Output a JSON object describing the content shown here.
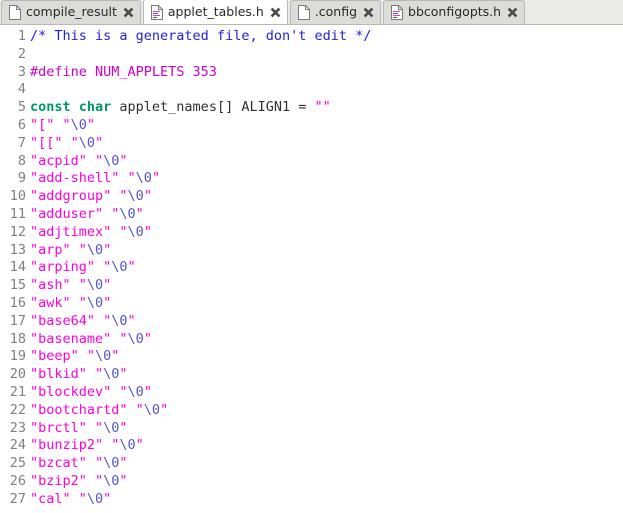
{
  "window": {
    "title": "applet_tables.h"
  },
  "tabbar": {
    "tabs": [
      {
        "label": "compile_result",
        "icon": "plain-document-icon",
        "close_icon": "close-icon",
        "active": false
      },
      {
        "label": "applet_tables.h",
        "icon": "text-document-icon",
        "close_icon": "close-icon",
        "active": true
      },
      {
        "label": ".config",
        "icon": "plain-document-icon",
        "close_icon": "close-icon",
        "active": false
      },
      {
        "label": "bbconfigopts.h",
        "icon": "text-document-icon",
        "close_icon": "close-icon",
        "active": false
      }
    ]
  },
  "colors": {
    "comment": "#2222dd",
    "preprocessor": "#cc00cc",
    "keyword": "#009966",
    "identifier": "#303030",
    "string": "#ff00dd",
    "escape": "#5555cc",
    "linenumber": "#808080",
    "tab_active_bg": "#ffffff",
    "tab_inactive_bg": "#dcdcd8",
    "tabbar_bg": "#ebebe9",
    "editor_bg": "#ffffff"
  },
  "editor": {
    "lines": [
      {
        "n": "1",
        "tokens": [
          {
            "t": "/* This is a generated file, don't edit */",
            "c": "comment"
          }
        ]
      },
      {
        "n": "2",
        "tokens": []
      },
      {
        "n": "3",
        "tokens": [
          {
            "t": "#define NUM_APPLETS 353",
            "c": "preprocessor"
          }
        ]
      },
      {
        "n": "4",
        "tokens": []
      },
      {
        "n": "5",
        "tokens": [
          {
            "t": "const char",
            "c": "keyword",
            "bold": true
          },
          {
            "t": " applet_names[] ALIGN1 = ",
            "c": "identifier"
          },
          {
            "t": "\"\"",
            "c": "string"
          }
        ]
      },
      {
        "n": "6",
        "tokens": [
          {
            "t": "\"[\" \"",
            "c": "string"
          },
          {
            "t": "\\0",
            "c": "escape"
          },
          {
            "t": "\"",
            "c": "string"
          }
        ]
      },
      {
        "n": "7",
        "tokens": [
          {
            "t": "\"[[\" \"",
            "c": "string"
          },
          {
            "t": "\\0",
            "c": "escape"
          },
          {
            "t": "\"",
            "c": "string"
          }
        ]
      },
      {
        "n": "8",
        "tokens": [
          {
            "t": "\"acpid\" \"",
            "c": "string"
          },
          {
            "t": "\\0",
            "c": "escape"
          },
          {
            "t": "\"",
            "c": "string"
          }
        ]
      },
      {
        "n": "9",
        "tokens": [
          {
            "t": "\"add-shell\" \"",
            "c": "string"
          },
          {
            "t": "\\0",
            "c": "escape"
          },
          {
            "t": "\"",
            "c": "string"
          }
        ]
      },
      {
        "n": "10",
        "tokens": [
          {
            "t": "\"addgroup\" \"",
            "c": "string"
          },
          {
            "t": "\\0",
            "c": "escape"
          },
          {
            "t": "\"",
            "c": "string"
          }
        ]
      },
      {
        "n": "11",
        "tokens": [
          {
            "t": "\"adduser\" \"",
            "c": "string"
          },
          {
            "t": "\\0",
            "c": "escape"
          },
          {
            "t": "\"",
            "c": "string"
          }
        ]
      },
      {
        "n": "12",
        "tokens": [
          {
            "t": "\"adjtimex\" \"",
            "c": "string"
          },
          {
            "t": "\\0",
            "c": "escape"
          },
          {
            "t": "\"",
            "c": "string"
          }
        ]
      },
      {
        "n": "13",
        "tokens": [
          {
            "t": "\"arp\" \"",
            "c": "string"
          },
          {
            "t": "\\0",
            "c": "escape"
          },
          {
            "t": "\"",
            "c": "string"
          }
        ]
      },
      {
        "n": "14",
        "tokens": [
          {
            "t": "\"arping\" \"",
            "c": "string"
          },
          {
            "t": "\\0",
            "c": "escape"
          },
          {
            "t": "\"",
            "c": "string"
          }
        ]
      },
      {
        "n": "15",
        "tokens": [
          {
            "t": "\"ash\" \"",
            "c": "string"
          },
          {
            "t": "\\0",
            "c": "escape"
          },
          {
            "t": "\"",
            "c": "string"
          }
        ]
      },
      {
        "n": "16",
        "tokens": [
          {
            "t": "\"awk\" \"",
            "c": "string"
          },
          {
            "t": "\\0",
            "c": "escape"
          },
          {
            "t": "\"",
            "c": "string"
          }
        ]
      },
      {
        "n": "17",
        "tokens": [
          {
            "t": "\"base64\" \"",
            "c": "string"
          },
          {
            "t": "\\0",
            "c": "escape"
          },
          {
            "t": "\"",
            "c": "string"
          }
        ]
      },
      {
        "n": "18",
        "tokens": [
          {
            "t": "\"basename\" \"",
            "c": "string"
          },
          {
            "t": "\\0",
            "c": "escape"
          },
          {
            "t": "\"",
            "c": "string"
          }
        ]
      },
      {
        "n": "19",
        "tokens": [
          {
            "t": "\"beep\" \"",
            "c": "string"
          },
          {
            "t": "\\0",
            "c": "escape"
          },
          {
            "t": "\"",
            "c": "string"
          }
        ]
      },
      {
        "n": "20",
        "tokens": [
          {
            "t": "\"blkid\" \"",
            "c": "string"
          },
          {
            "t": "\\0",
            "c": "escape"
          },
          {
            "t": "\"",
            "c": "string"
          }
        ]
      },
      {
        "n": "21",
        "tokens": [
          {
            "t": "\"blockdev\" \"",
            "c": "string"
          },
          {
            "t": "\\0",
            "c": "escape"
          },
          {
            "t": "\"",
            "c": "string"
          }
        ]
      },
      {
        "n": "22",
        "tokens": [
          {
            "t": "\"bootchartd\" \"",
            "c": "string"
          },
          {
            "t": "\\0",
            "c": "escape"
          },
          {
            "t": "\"",
            "c": "string"
          }
        ]
      },
      {
        "n": "23",
        "tokens": [
          {
            "t": "\"brctl\" \"",
            "c": "string"
          },
          {
            "t": "\\0",
            "c": "escape"
          },
          {
            "t": "\"",
            "c": "string"
          }
        ]
      },
      {
        "n": "24",
        "tokens": [
          {
            "t": "\"bunzip2\" \"",
            "c": "string"
          },
          {
            "t": "\\0",
            "c": "escape"
          },
          {
            "t": "\"",
            "c": "string"
          }
        ]
      },
      {
        "n": "25",
        "tokens": [
          {
            "t": "\"bzcat\" \"",
            "c": "string"
          },
          {
            "t": "\\0",
            "c": "escape"
          },
          {
            "t": "\"",
            "c": "string"
          }
        ]
      },
      {
        "n": "26",
        "tokens": [
          {
            "t": "\"bzip2\" \"",
            "c": "string"
          },
          {
            "t": "\\0",
            "c": "escape"
          },
          {
            "t": "\"",
            "c": "string"
          }
        ]
      },
      {
        "n": "27",
        "tokens": [
          {
            "t": "\"cal\" \"",
            "c": "string"
          },
          {
            "t": "\\0",
            "c": "escape"
          },
          {
            "t": "\"",
            "c": "string"
          }
        ]
      }
    ]
  }
}
